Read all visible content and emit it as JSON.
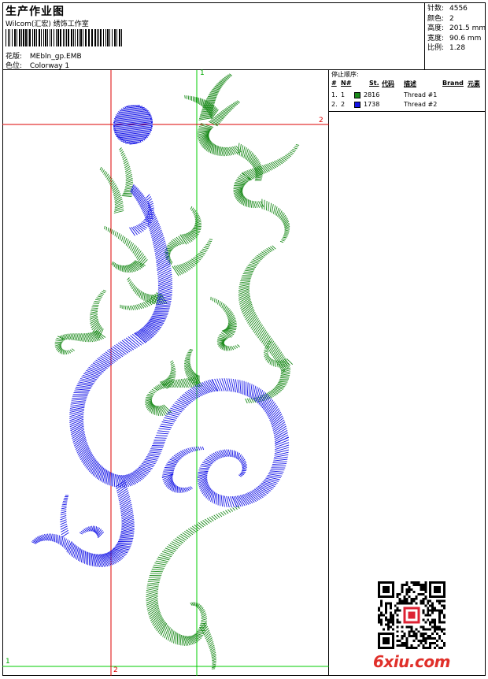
{
  "header": {
    "title": "生产作业图",
    "subtitle": "Wilcom(汇宏) 绣饰工作室",
    "design_label": "花版:",
    "design_value": "MEbln_gp.EMB",
    "colorway_label": "色位:",
    "colorway_value": "Colorway 1"
  },
  "stats": [
    {
      "label": "针数:",
      "value": "4556"
    },
    {
      "label": "颜色:",
      "value": "2"
    },
    {
      "label": "高度:",
      "value": "201.5 mm"
    },
    {
      "label": "宽度:",
      "value": "90.6 mm"
    },
    {
      "label": "比例:",
      "value": "1.28"
    }
  ],
  "stop_sequence": {
    "title": "停止顺序:",
    "columns": [
      "#",
      "N#",
      "St.",
      "代码",
      "描述",
      "Brand",
      "元素"
    ],
    "rows": [
      {
        "index": "1.",
        "n": "1",
        "color": "#1a8a1a",
        "stitches": "2816",
        "description": "Thread #1"
      },
      {
        "index": "2.",
        "n": "2",
        "color": "#1414e6",
        "stitches": "1738",
        "description": "Thread #2"
      }
    ]
  },
  "guides": {
    "label_1": "1",
    "label_2": "2",
    "green": "#00cc00",
    "red": "#dd0000"
  },
  "thread_colors": {
    "thread_1": "#1a8a1a",
    "thread_2": "#1414e6"
  },
  "watermark": {
    "text": "6xiu.com"
  }
}
